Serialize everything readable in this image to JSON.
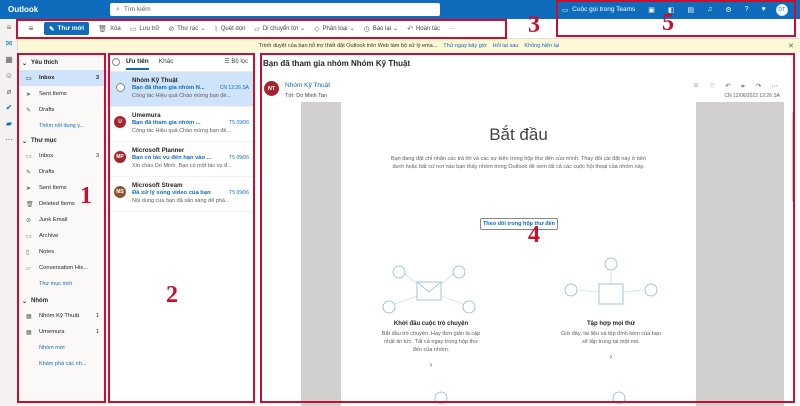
{
  "topbar": {
    "app_name": "Outlook",
    "search_placeholder": "Tìm kiếm",
    "teams_label": "Cuộc gọi trong Teams",
    "avatar": "DT"
  },
  "ribbon": {
    "new_mail": "Thư mới",
    "items": [
      "Xóa",
      "Lưu trữ",
      "Thư rác",
      "Quét dọn",
      "Di chuyển tới",
      "Phân loại",
      "Báo lại",
      "Hoàn tác"
    ],
    "more": "···"
  },
  "infobar": {
    "text": "Trình duyệt của bạn hỗ trợ thiết đặt Outlook trên Web làm bộ xử lý ema...",
    "link1": "Thử ngay bây giờ",
    "link2": "Hỏi lại sau",
    "link3": "Không hiện lại"
  },
  "folders": {
    "favorites_header": "Yêu thích",
    "favorites": [
      {
        "label": "Inbox",
        "count": "3"
      },
      {
        "label": "Sent Items",
        "count": ""
      },
      {
        "label": "Drafts",
        "count": ""
      }
    ],
    "favorites_more": "Thêm nội dung y...",
    "mail_header": "Thư mục",
    "mail": [
      {
        "label": "Inbox",
        "count": "3"
      },
      {
        "label": "Drafts",
        "count": ""
      },
      {
        "label": "Sent Items",
        "count": ""
      },
      {
        "label": "Deleted Items",
        "count": ""
      },
      {
        "label": "Junk Email",
        "count": ""
      },
      {
        "label": "Archive",
        "count": ""
      },
      {
        "label": "Notes",
        "count": ""
      },
      {
        "label": "Conversation His...",
        "count": ""
      }
    ],
    "new_folder": "Thư mục mới",
    "groups_header": "Nhóm",
    "groups": [
      {
        "label": "Nhóm Kỹ Thuật",
        "count": "1"
      },
      {
        "label": "Umemura",
        "count": "1"
      }
    ],
    "new_group": "Nhóm mới",
    "discover_groups": "Khám phá các nh..."
  },
  "msglist": {
    "tab_focused": "Ưu tiên",
    "tab_other": "Khác",
    "filter": "Bộ lọc",
    "messages": [
      {
        "sender": "Nhóm Kỹ Thuật",
        "subject": "Bạn đã tham gia nhóm N...",
        "date": "CN 12:26 SA",
        "preview": "Công tác Hiệu quả Chào mừng bạn đế...",
        "initials": "",
        "color": "#ffffff"
      },
      {
        "sender": "Umemura",
        "subject": "Bạn đã tham gia nhóm ...",
        "date": "T5 09/06",
        "preview": "Công tác Hiệu quả Chào mừng bạn đế...",
        "initials": "U",
        "color": "#a4262c"
      },
      {
        "sender": "Microsoft Planner",
        "subject": "Bạn có tác vụ đến hạn vào ...",
        "date": "T5 09/06",
        "preview": "Xin chào Do Minh, Bạn có một tác vụ đ...",
        "initials": "MP",
        "color": "#a4262c"
      },
      {
        "sender": "Microsoft Stream",
        "subject": "Đã xử lý xong video của bạn",
        "date": "T5 09/06",
        "preview": "Nội dung của bạn đã sẵn sàng để phá...",
        "initials": "MS",
        "color": "#8e562e"
      }
    ]
  },
  "reading": {
    "title": "Bạn đã tham gia nhóm Nhóm Kỹ Thuật",
    "avatar": "NT",
    "sender": "Nhóm Kỹ Thuật",
    "to": "Tới:  Do Minh Tan",
    "date": "CN 12/06/2022 12:26 SA",
    "heading": "Bắt đầu",
    "body": "Bạn đang đặt chỉ nhân các trả lời và các sự kiện trong hộp thư đến của mình. Thay đổi cài đặt này ở bên dưới hoặc bất cứ nơi nào bạn thấy nhóm trong Outlook để xem tất cả các cuộc hội thoại của nhóm này.",
    "button": "Theo dõi trong hộp thư đến",
    "feature1_title": "Khởi đầu cuộc trò chuyện",
    "feature1_desc": "Bắt đầu trò chuyện. Hay đơn giản là cập nhật tin tức. Tất cả ngay trong hộp thư đến của nhóm.",
    "feature2_title": "Tập hợp mọi thứ",
    "feature2_desc": "Giờ đây, tài liệu và tệp đính kèm của bạn sẽ tập trung tại một nơi.",
    "arrow": "›"
  },
  "annotations": [
    "1",
    "2",
    "3",
    "4",
    "5"
  ],
  "colors": {
    "accent": "#0f6cbd",
    "annotation": "#c8102e",
    "selected": "#cfe4fa"
  }
}
